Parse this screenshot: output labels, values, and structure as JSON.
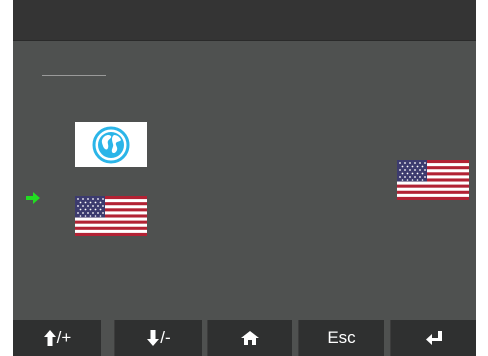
{
  "header": {
    "title": ""
  },
  "languages": [
    {
      "icon": "globe-icon"
    },
    {
      "icon": "us-flag-icon"
    }
  ],
  "current_language": {
    "icon": "us-flag-icon"
  },
  "selection_indicator": {
    "icon": "arrow-right-icon",
    "color": "#22dd22"
  },
  "softkeys": [
    {
      "name": "up-plus",
      "icon": "arrow-up-icon",
      "label": "/+"
    },
    {
      "name": "down-minus",
      "icon": "arrow-down-icon",
      "label": "/-"
    },
    {
      "name": "home",
      "icon": "home-icon",
      "label": ""
    },
    {
      "name": "escape",
      "icon": "",
      "label": "Esc"
    },
    {
      "name": "enter",
      "icon": "enter-icon",
      "label": ""
    }
  ],
  "colors": {
    "panel": "#4f5150",
    "title_bar": "#343434",
    "softkey": "#2f3030",
    "globe": "#2bb5e8"
  }
}
